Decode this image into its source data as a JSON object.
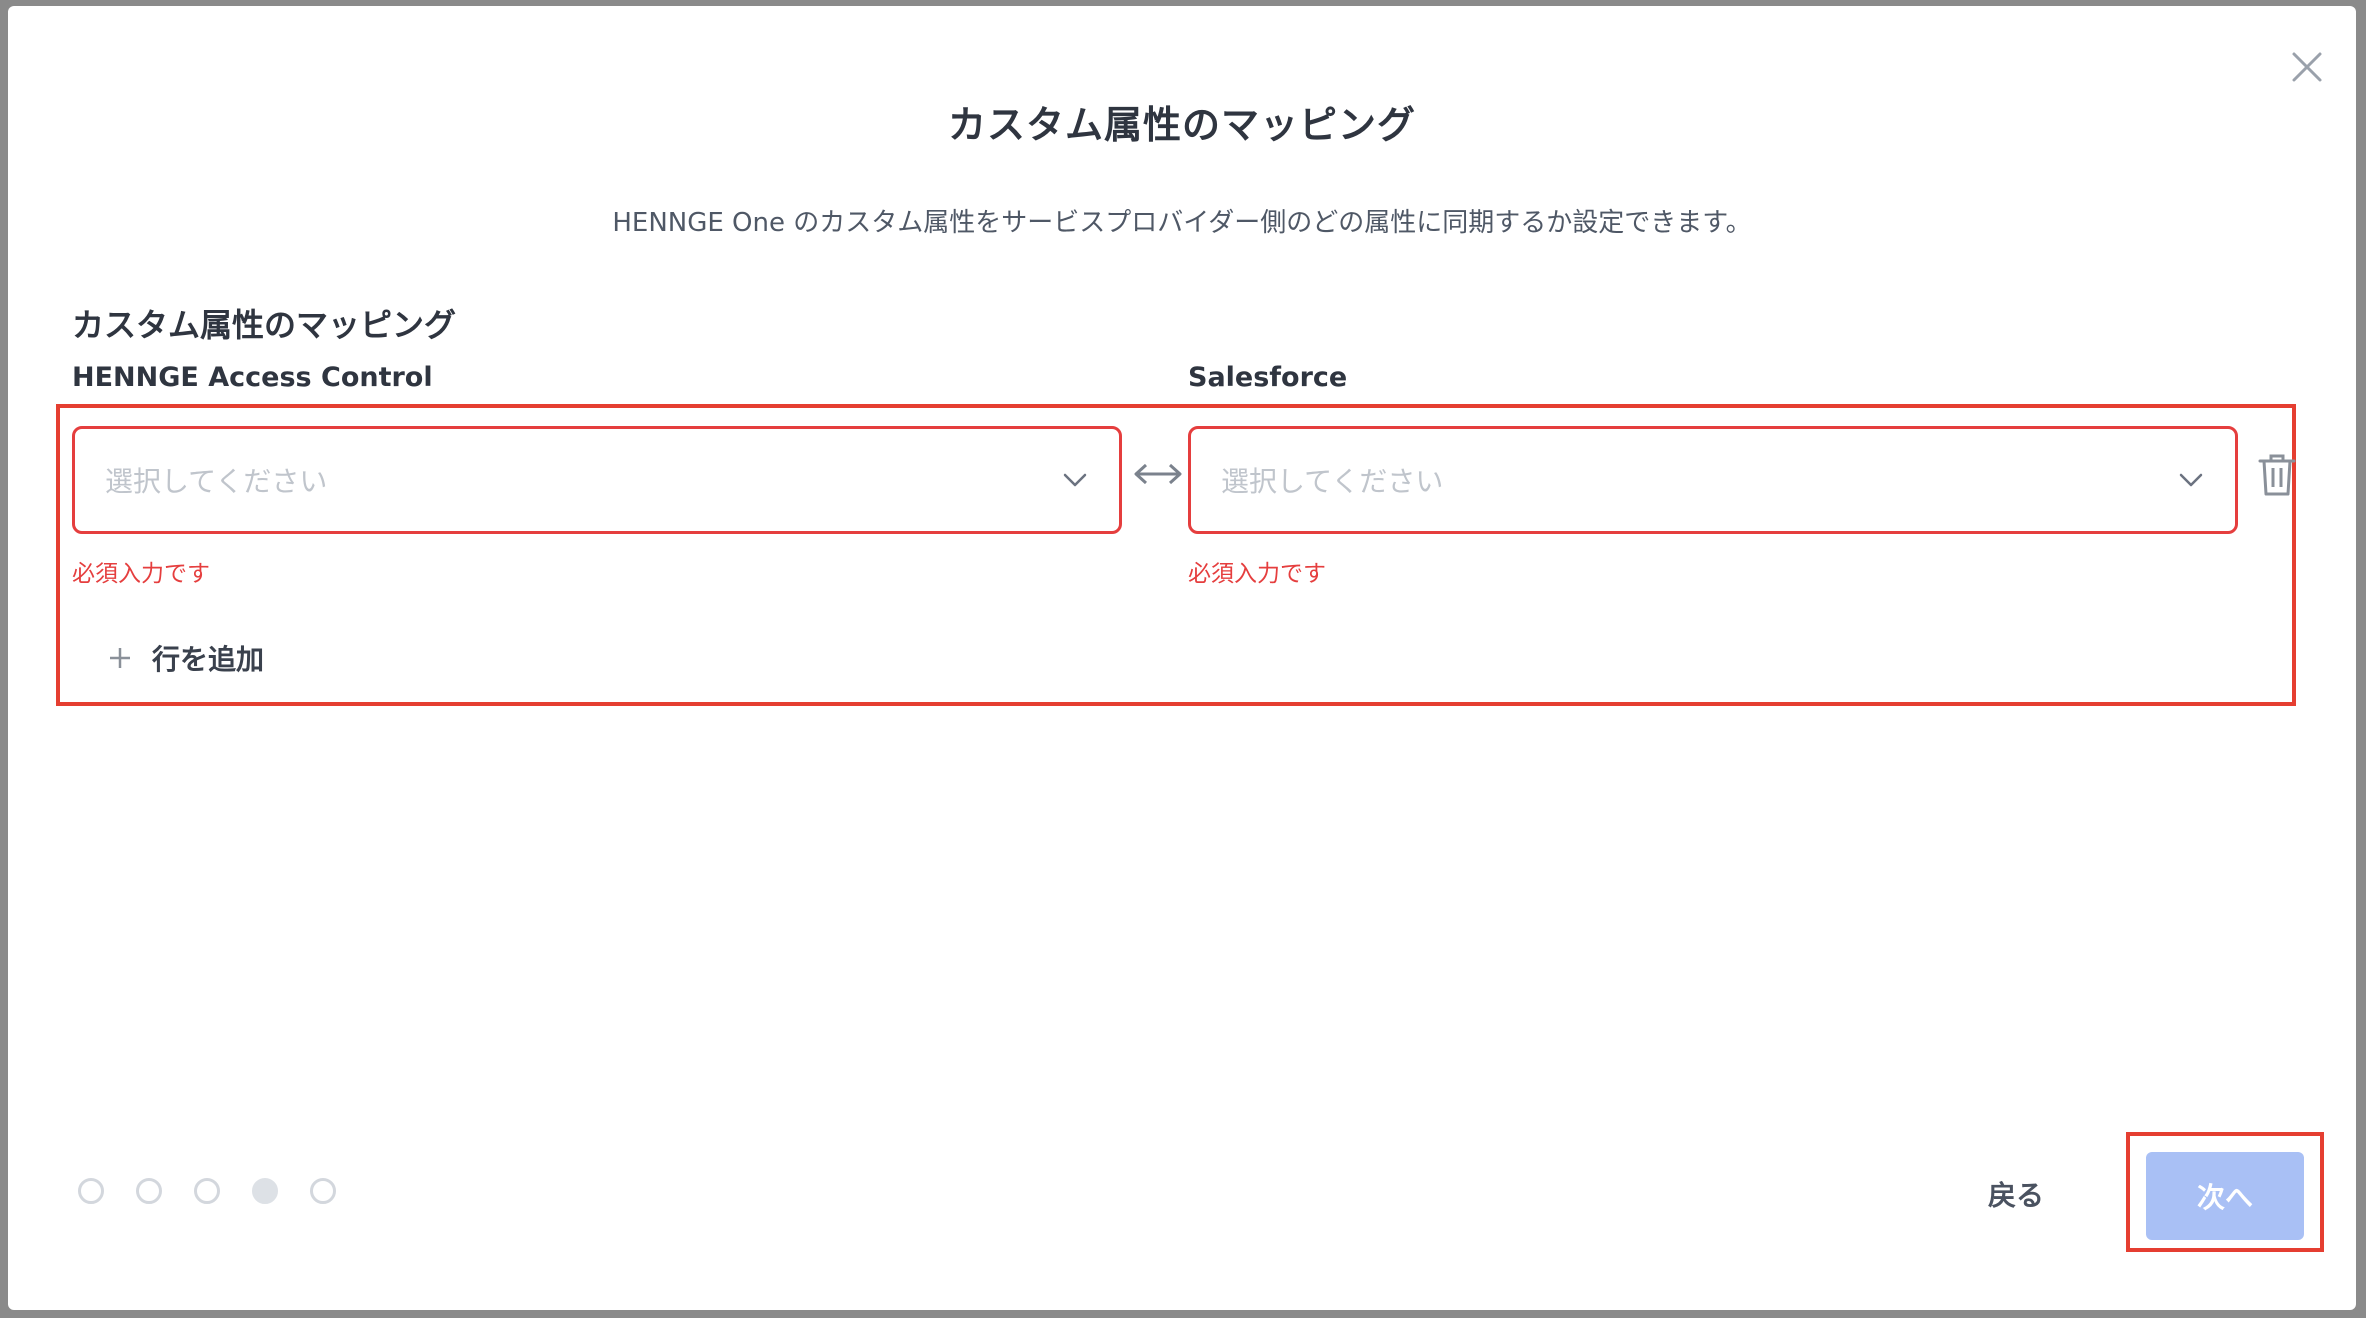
{
  "dialog": {
    "title": "カスタム属性のマッピング",
    "description": "HENNGE One のカスタム属性をサービスプロバイダー側のどの属性に同期するか設定できます。"
  },
  "mapping": {
    "section_title": "カスタム属性のマッピング",
    "left_label": "HENNGE Access Control",
    "right_label": "Salesforce",
    "rows": [
      {
        "left_placeholder": "選択してください",
        "right_placeholder": "選択してください",
        "left_error": "必須入力です",
        "right_error": "必須入力です"
      }
    ],
    "add_row_label": "行を追加"
  },
  "footer": {
    "steps": [
      {
        "active": false
      },
      {
        "active": false
      },
      {
        "active": false
      },
      {
        "active": true
      },
      {
        "active": false
      }
    ],
    "back_label": "戻る",
    "next_label": "次へ"
  },
  "colors": {
    "error": "#e53e3e",
    "highlight": "#e53e31",
    "primary_disabled": "#a9c0f5"
  },
  "icons": {
    "close": "close-icon",
    "chevron": "chevron-down-icon",
    "swap": "arrows-left-right-icon",
    "delete": "trash-icon",
    "add": "plus-icon"
  }
}
